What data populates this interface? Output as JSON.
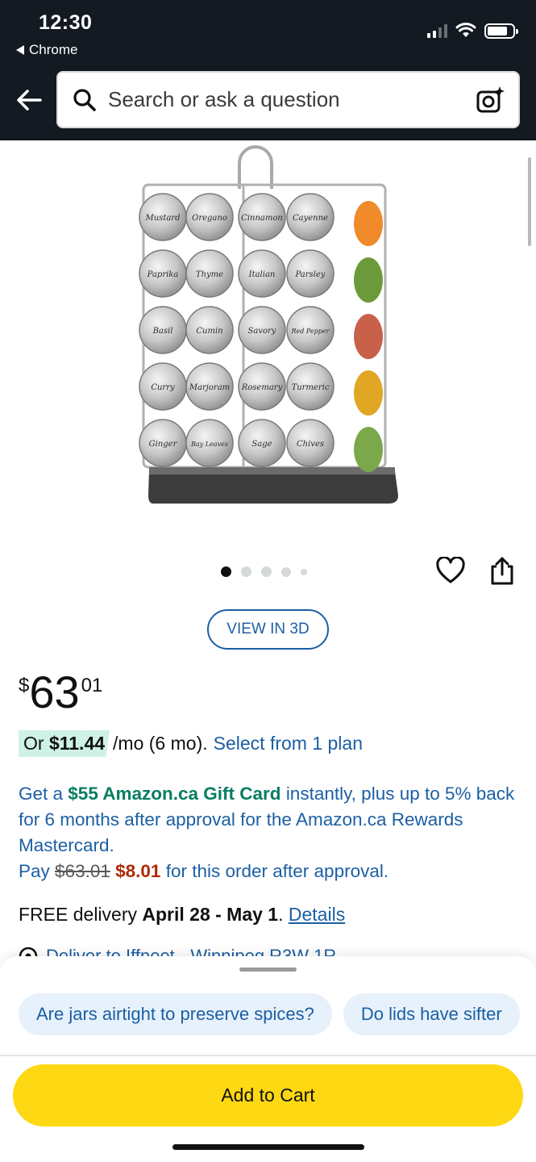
{
  "status_bar": {
    "time": "12:30",
    "back_app": "Chrome"
  },
  "search": {
    "placeholder": "Search or ask a question"
  },
  "image_carousel": {
    "total": 5,
    "active_index": 0
  },
  "spice_labels": {
    "row1": [
      "Mustard",
      "Oregano",
      "Cinnamon",
      "Cayenne"
    ],
    "row2": [
      "Paprika",
      "Thyme",
      "Italian",
      "Parsley"
    ],
    "row3": [
      "Basil",
      "Cumin",
      "Savory",
      "Red Pepper"
    ],
    "row4": [
      "Curry",
      "Marjoram",
      "Rosemary",
      "Turmeric"
    ],
    "row5": [
      "Ginger",
      "Bay Leaves",
      "Sage",
      "Chives"
    ]
  },
  "view_3d_label": "VIEW IN 3D",
  "price": {
    "symbol": "$",
    "whole": "63",
    "fraction": "01"
  },
  "monthly": {
    "prefix": "Or",
    "amount": "$11.44",
    "suffix": "/mo (6 mo).",
    "link": "Select from 1 plan"
  },
  "promo": {
    "text1": "Get a",
    "gift_card": "$55 Amazon.ca Gift Card",
    "text2": "instantly, plus up to 5% back for 6 months after approval for the Amazon.ca Rewards Mastercard.",
    "pay_label": "Pay",
    "old_price": "$63.01",
    "new_price": "$8.01",
    "text3": "for this order after approval."
  },
  "delivery": {
    "prefix": "FREE delivery",
    "dates": "April 28 - May 1",
    "period": ".",
    "details_link": "Details"
  },
  "deliver_to": {
    "text": "Deliver to Iffneet - Winnipeg R3W 1R"
  },
  "chips": [
    "Are jars airtight to preserve spices?",
    "Do lids have sifter"
  ],
  "add_to_cart_label": "Add to Cart",
  "colors": {
    "header_bg": "#131A22",
    "link": "#1C5FA4",
    "gift_green": "#067D62",
    "price_red": "#B12704",
    "cart_yellow": "#FFD814",
    "chip_bg": "#E6F1FB",
    "monthly_highlight": "#CFF1E6"
  }
}
